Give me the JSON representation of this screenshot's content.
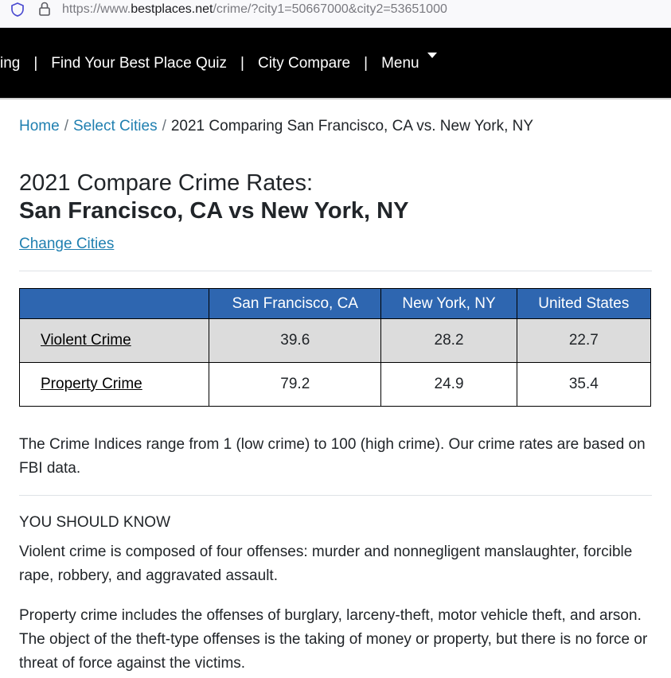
{
  "browser": {
    "url_prefix": "https://www.",
    "url_host": "bestplaces.net",
    "url_path": "/crime/?city1=50667000&city2=53651000"
  },
  "nav": {
    "items": [
      {
        "label": "ing"
      },
      {
        "label": "Find Your Best Place Quiz"
      },
      {
        "label": "City Compare"
      },
      {
        "label": "Menu"
      }
    ],
    "separator": "|"
  },
  "breadcrumb": {
    "home": "Home",
    "select_cities": "Select Cities",
    "current": "2021 Comparing San Francisco, CA vs. New York, NY",
    "separator": "/"
  },
  "page": {
    "title_line1": "2021 Compare Crime Rates:",
    "title_line2": "San Francisco, CA vs New York, NY",
    "change_cities": "Change Cities"
  },
  "crime_table": {
    "headers": [
      "",
      "San Francisco, CA",
      "New York, NY",
      "United States"
    ],
    "rows": [
      {
        "label": "Violent Crime",
        "values": [
          "39.6",
          "28.2",
          "22.7"
        ]
      },
      {
        "label": "Property Crime",
        "values": [
          "79.2",
          "24.9",
          "35.4"
        ]
      }
    ]
  },
  "notes": {
    "indices": "The Crime Indices range from 1 (low crime) to 100 (high crime). Our crime rates are based on FBI data.",
    "should_know_heading": "YOU SHOULD KNOW",
    "violent": "Violent crime is composed of four offenses: murder and nonnegligent manslaughter, forcible rape, robbery, and aggravated assault.",
    "property": "Property crime includes the offenses of burglary, larceny-theft, motor vehicle theft, and arson. The object of the theft-type offenses is the taking of money or property, but there is no force or threat of force against the victims."
  },
  "colors": {
    "nav_bg": "#000000",
    "link": "#1f7fb0",
    "table_header_bg": "#2e66b0",
    "shaded_row_bg": "#dcdcdc"
  },
  "icons": {
    "tracking_protection": "shield-icon",
    "connection_secure": "lock-icon",
    "menu_dropdown": "caret-down-icon"
  }
}
